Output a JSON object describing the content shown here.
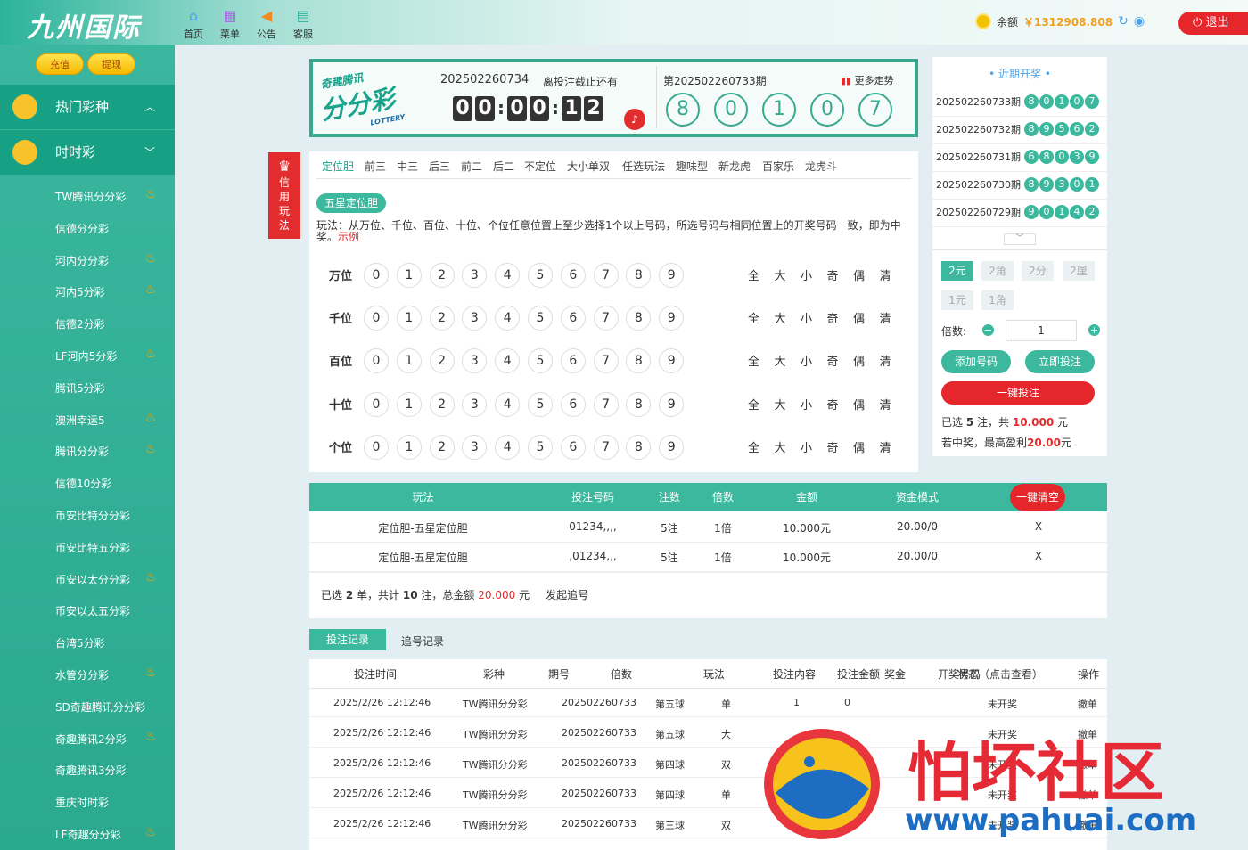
{
  "header": {
    "logo": "九州国际",
    "nav": [
      {
        "label": "首页",
        "icon": "home-icon"
      },
      {
        "label": "菜单",
        "icon": "grid-icon"
      },
      {
        "label": "公告",
        "icon": "megaphone-icon"
      },
      {
        "label": "客服",
        "icon": "chat-icon"
      }
    ],
    "balance_label": "余额",
    "balance": "￥1312908.808",
    "logout": "退出"
  },
  "sidebar": {
    "recharge": "充值",
    "withdraw": "提现",
    "groups": [
      {
        "label": "热门彩种"
      },
      {
        "label": "时时彩"
      }
    ],
    "items": [
      {
        "label": "TW腾讯分分彩",
        "hot": true
      },
      {
        "label": "信德分分彩",
        "hot": false
      },
      {
        "label": "河内分分彩",
        "hot": true
      },
      {
        "label": "河内5分彩",
        "hot": true
      },
      {
        "label": "信德2分彩",
        "hot": false
      },
      {
        "label": "LF河内5分彩",
        "hot": true
      },
      {
        "label": "腾讯5分彩",
        "hot": false
      },
      {
        "label": "澳洲幸运5",
        "hot": true
      },
      {
        "label": "腾讯分分彩",
        "hot": true
      },
      {
        "label": "信德10分彩",
        "hot": false
      },
      {
        "label": "币安比特分分彩",
        "hot": false
      },
      {
        "label": "币安比特五分彩",
        "hot": false
      },
      {
        "label": "币安以太分分彩",
        "hot": true
      },
      {
        "label": "币安以太五分彩",
        "hot": false
      },
      {
        "label": "台湾5分彩",
        "hot": false
      },
      {
        "label": "水管分分彩",
        "hot": true
      },
      {
        "label": "SD奇趣腾讯分分彩",
        "hot": false
      },
      {
        "label": "奇趣腾讯2分彩",
        "hot": true
      },
      {
        "label": "奇趣腾讯3分彩",
        "hot": false
      },
      {
        "label": "重庆时时彩",
        "hot": false
      },
      {
        "label": "LF奇趣分分彩",
        "hot": true
      }
    ]
  },
  "banner": {
    "logo_top": "奇趣腾讯",
    "logo_main": "分分彩",
    "logo_sub": "LOTTERY",
    "current_issue": "202502260734",
    "deadline_label": "离投注截止还有",
    "countdown": [
      "0",
      "0",
      "0",
      "0",
      "1",
      "2"
    ],
    "last_issue": "第202502260733期",
    "trend": "更多走势",
    "last_result": [
      "8",
      "0",
      "1",
      "0",
      "7"
    ]
  },
  "side_tab": "信用玩法",
  "play": {
    "tabs": [
      "定位胆",
      "前三",
      "中三",
      "后三",
      "前二",
      "后二",
      "不定位",
      "大小单双",
      "任选玩法",
      "趣味型",
      "新龙虎",
      "百家乐",
      "龙虎斗"
    ],
    "subtab": "五星定位胆",
    "desc": "玩法：从万位、千位、百位、十位、个位任意位置上至少选择1个以上号码，所选号码与相同位置上的开奖号码一致，即为中奖。",
    "example": "示例",
    "rows": [
      "万位",
      "千位",
      "百位",
      "十位",
      "个位"
    ],
    "numbers": [
      "0",
      "1",
      "2",
      "3",
      "4",
      "5",
      "6",
      "7",
      "8",
      "9"
    ],
    "quick": [
      "全",
      "大",
      "小",
      "奇",
      "偶",
      "清"
    ]
  },
  "recent": {
    "title": "近期开奖",
    "draws": [
      {
        "issue": "202502260733期",
        "nums": [
          "8",
          "0",
          "1",
          "0",
          "7"
        ]
      },
      {
        "issue": "202502260732期",
        "nums": [
          "8",
          "9",
          "5",
          "6",
          "2"
        ]
      },
      {
        "issue": "202502260731期",
        "nums": [
          "6",
          "8",
          "0",
          "3",
          "9"
        ]
      },
      {
        "issue": "202502260730期",
        "nums": [
          "8",
          "9",
          "3",
          "0",
          "1"
        ]
      },
      {
        "issue": "202502260729期",
        "nums": [
          "9",
          "0",
          "1",
          "4",
          "2"
        ]
      }
    ]
  },
  "bet": {
    "units": [
      "2元",
      "2角",
      "2分",
      "2厘",
      "1元",
      "1角"
    ],
    "multiple_label": "倍数:",
    "multiple": "1",
    "add": "添加号码",
    "now": "立即投注",
    "one_click": "一键投注",
    "sel_prefix": "已选",
    "sel_count": "5",
    "sel_mid": "注，共",
    "sel_amount": "10.000",
    "sel_unit": "元",
    "win_prefix": "若中奖，最高盈利",
    "win_amount": "20.00",
    "win_unit": "元"
  },
  "cart": {
    "headers": [
      "玩法",
      "投注号码",
      "注数",
      "倍数",
      "金额",
      "资金模式"
    ],
    "clear": "一键清空",
    "rows": [
      [
        "定位胆-五星定位胆",
        "01234,,,,",
        "5注",
        "1倍",
        "10.000元",
        "20.00/0",
        "X"
      ],
      [
        "定位胆-五星定位胆",
        ",01234,,,",
        "5注",
        "1倍",
        "10.000元",
        "20.00/0",
        "X"
      ]
    ],
    "sum_a": "已选",
    "sum_orders": "2",
    "sum_b": "单，共计",
    "sum_bets": "10",
    "sum_c": "注，总金额",
    "sum_amount": "20.000",
    "sum_d": "元",
    "chase": "发起追号"
  },
  "records": {
    "tabs": [
      "投注记录",
      "追号记录"
    ],
    "headers": [
      "投注时间",
      "彩种",
      "期号",
      "倍数",
      "玩法",
      "投注内容",
      "投注金额",
      "奖金",
      "开奖号码",
      "状态（点击查看）",
      "操作"
    ],
    "rows": [
      [
        "2025/2/26 12:12:46",
        "TW腾讯分分彩",
        "202502260733",
        "第五球",
        "单",
        "1",
        "0",
        "未开奖",
        "撤单"
      ],
      [
        "2025/2/26 12:12:46",
        "TW腾讯分分彩",
        "202502260733",
        "第五球",
        "大",
        "",
        "",
        "未开奖",
        "撤单"
      ],
      [
        "2025/2/26 12:12:46",
        "TW腾讯分分彩",
        "202502260733",
        "第四球",
        "双",
        "",
        "",
        "未开奖",
        "撤单"
      ],
      [
        "2025/2/26 12:12:46",
        "TW腾讯分分彩",
        "202502260733",
        "第四球",
        "单",
        "",
        "",
        "未开奖",
        "撤单"
      ],
      [
        "2025/2/26 12:12:46",
        "TW腾讯分分彩",
        "202502260733",
        "第三球",
        "双",
        "",
        "",
        "未开奖",
        "撤单"
      ]
    ]
  },
  "watermark": {
    "text": "怕坏社区",
    "url": "www.pahuai.com"
  },
  "colors": {
    "accent": "#3bb89d",
    "red": "#e22c2e",
    "gold": "#f5b900"
  }
}
